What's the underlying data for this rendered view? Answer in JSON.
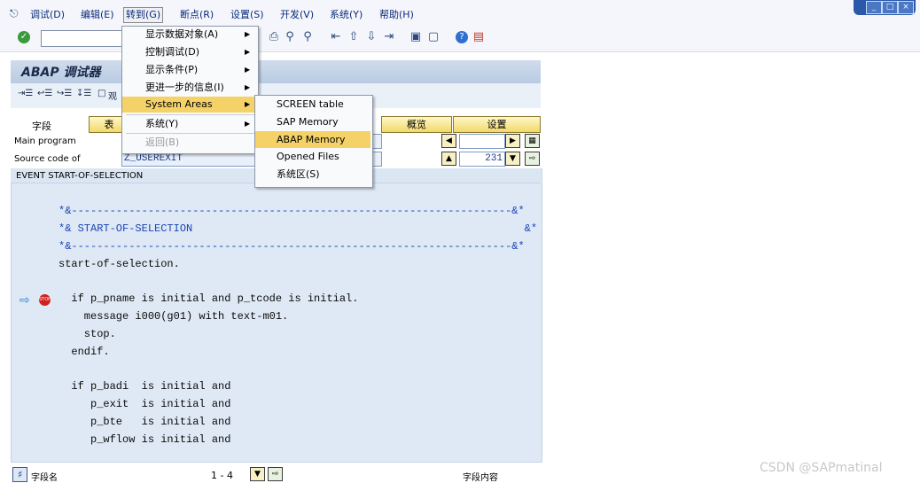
{
  "menubar": {
    "items": [
      "调试(D)",
      "编辑(E)",
      "转到(G)",
      "断点(R)",
      "设置(S)",
      "开发(V)",
      "系统(Y)",
      "帮助(H)"
    ],
    "active": "转到(G)"
  },
  "window_controls": [
    "_",
    "□",
    "×"
  ],
  "toolbar": {
    "command_value": ""
  },
  "title": "ABAP 调试器",
  "app_toolbar": {
    "watch_label": "观"
  },
  "tabs": [
    "字段",
    "表",
    "概览",
    "设置"
  ],
  "fields": {
    "main_program": {
      "label": "Main program",
      "value": ""
    },
    "source_code": {
      "label": "Source code of",
      "value": "Z_USEREXIT"
    },
    "line_number": "231"
  },
  "code_header": "EVENT START-OF-SELECTION",
  "code_lines": [
    "*&---------------------------------------------------------------------&*",
    "*& START-OF-SELECTION                                                    &*",
    "*&---------------------------------------------------------------------&*",
    "start-of-selection.",
    "  if p_pname is initial and p_tcode is initial.",
    "    message i000(g01) with text-m01.",
    "    stop.",
    "  endif.",
    "  if p_badi  is initial and",
    "     p_exit  is initial and",
    "     p_bte   is initial and",
    "     p_wflow is initial and"
  ],
  "goto_menu": [
    {
      "label": "显示数据对象(A)",
      "arrow": true,
      "state": "normal"
    },
    {
      "label": "控制调试(D)",
      "arrow": true,
      "state": "normal"
    },
    {
      "label": "显示条件(P)",
      "arrow": true,
      "state": "normal"
    },
    {
      "label": "更进一步的信息(I)",
      "arrow": true,
      "state": "normal"
    },
    {
      "label": "System Areas",
      "arrow": true,
      "state": "selected"
    },
    {
      "label": "系统(Y)",
      "arrow": true,
      "state": "normal"
    },
    {
      "label": "返回(B)",
      "arrow": false,
      "state": "disabled"
    }
  ],
  "system_areas_menu": [
    {
      "label": "SCREEN table",
      "state": "normal"
    },
    {
      "label": "SAP Memory",
      "state": "normal"
    },
    {
      "label": "ABAP Memory",
      "state": "selected"
    },
    {
      "label": "Opened Files",
      "state": "normal"
    },
    {
      "label": "系统区(S)",
      "state": "normal"
    }
  ],
  "bottom": {
    "field_name_label": "字段名",
    "pager": "1 - 4",
    "field_content_label": "字段内容"
  },
  "watermark": "CSDN @SAPmatinal",
  "colors": {
    "menu_highlight": "#f4d268",
    "tab_yellow": "#f2d96a",
    "code_panel": "#dfe9f5",
    "code_comment_blue": "#1b44b8"
  }
}
